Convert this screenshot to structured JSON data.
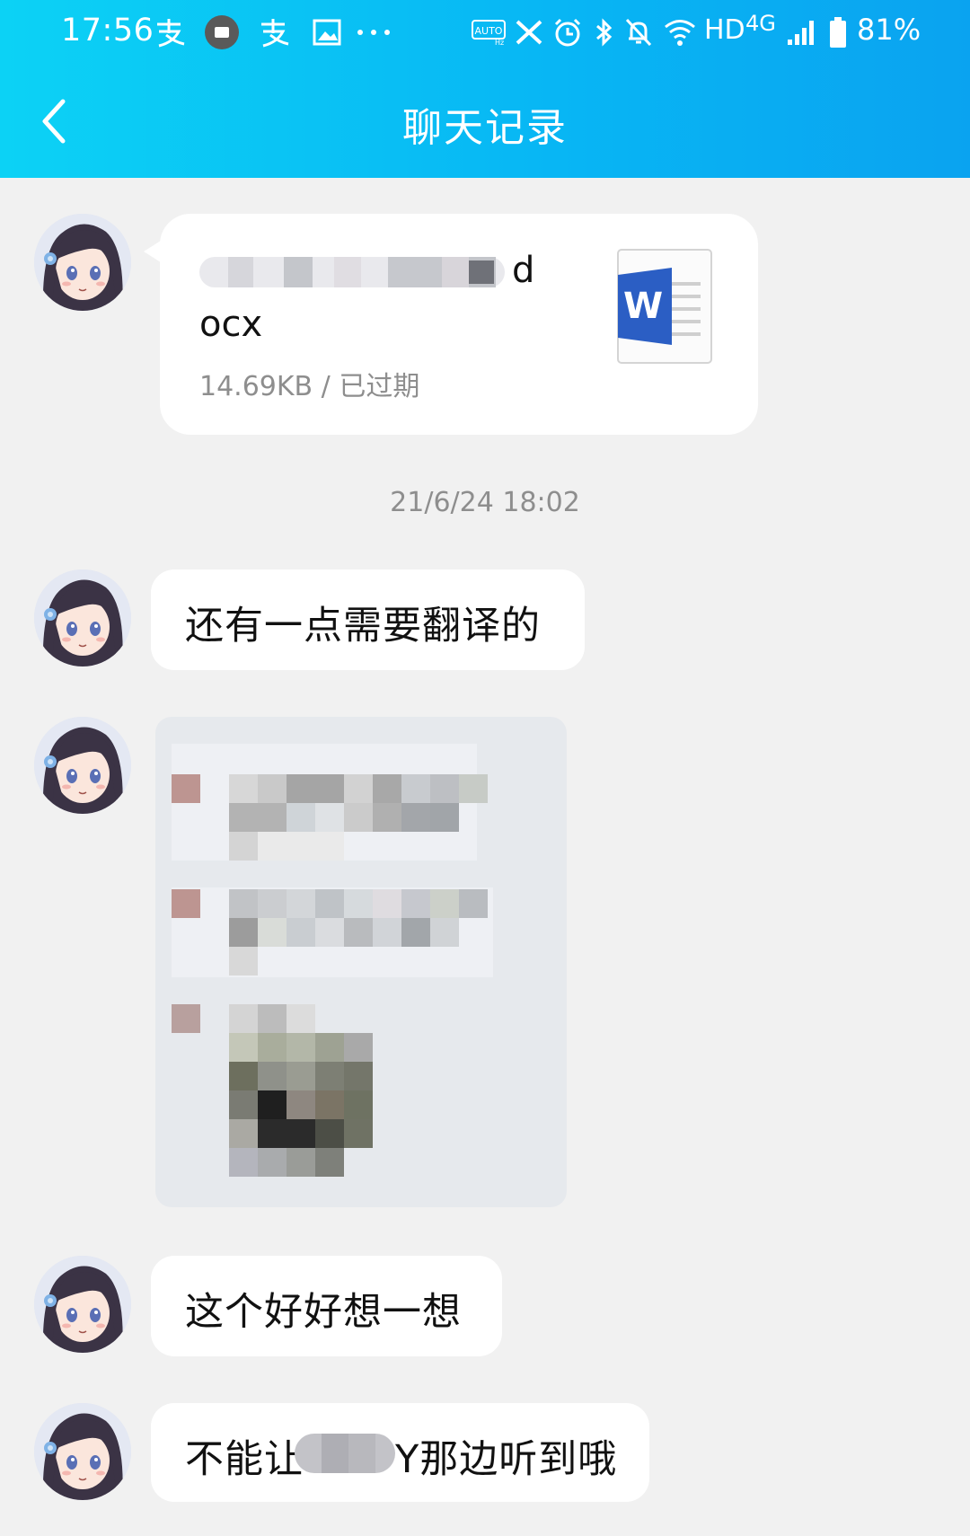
{
  "status_bar": {
    "time": "17:56",
    "network": "HD",
    "signal_type": "4G",
    "battery": "81%",
    "icons": [
      "alipay-icon",
      "notification-icon",
      "alipay-icon",
      "gallery-icon",
      "more-dots-icon",
      "auto-hz-icon",
      "x-icon",
      "alarm-icon",
      "bluetooth-icon",
      "mute-icon",
      "wifi-icon",
      "signal-icon",
      "battery-icon"
    ]
  },
  "header": {
    "title": "聊天记录",
    "back_icon": "chevron-left-icon"
  },
  "colors": {
    "header_start": "#0cd2f5",
    "header_end": "#0aa3f0",
    "page_bg": "#f1f1f1",
    "bubble_bg": "#ffffff",
    "meta_text": "#8e8e8e",
    "word_blue": "#2b5ec4"
  },
  "messages": [
    {
      "type": "file",
      "file_name_visible_suffix_1": "d",
      "file_name_visible_suffix_2": "ocx",
      "file_meta": "14.69KB / 已过期",
      "file_icon": "word-doc-icon"
    },
    {
      "type": "timestamp",
      "text": "21/6/24 18:02"
    },
    {
      "type": "text",
      "text": "还有一点需要翻译的"
    },
    {
      "type": "image",
      "content": "blurred screenshot"
    },
    {
      "type": "text",
      "text": "这个好好想一想"
    },
    {
      "type": "text",
      "text_before_blur": "不能让",
      "text_after_blur": "Y那边听到哦"
    }
  ]
}
